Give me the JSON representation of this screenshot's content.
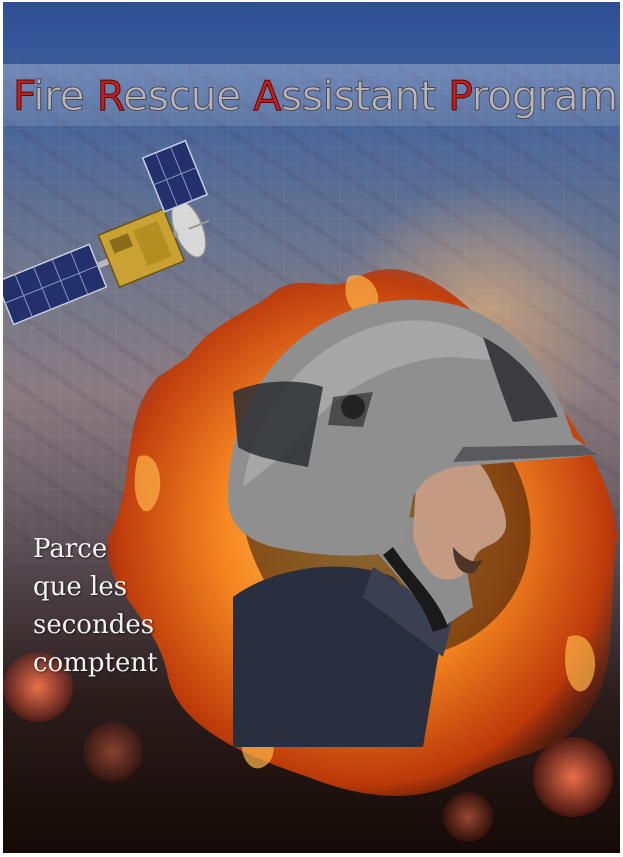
{
  "title": {
    "words": [
      {
        "cap": "F",
        "rest": "ire"
      },
      {
        "cap": "R",
        "rest": "escue"
      },
      {
        "cap": "A",
        "rest": "ssistant"
      },
      {
        "cap": "P",
        "rest": "rogram"
      }
    ]
  },
  "slogan": [
    "Parce",
    "que les",
    "secondes",
    "comptent"
  ],
  "colors": {
    "accent": "#c0201a",
    "title_text": "#b9b5ba",
    "sky": "#2d4f94"
  },
  "icons": {
    "satellite": "satellite-icon",
    "firefighter": "firefighter-helmet-icon",
    "fire": "fire-ring-icon"
  }
}
